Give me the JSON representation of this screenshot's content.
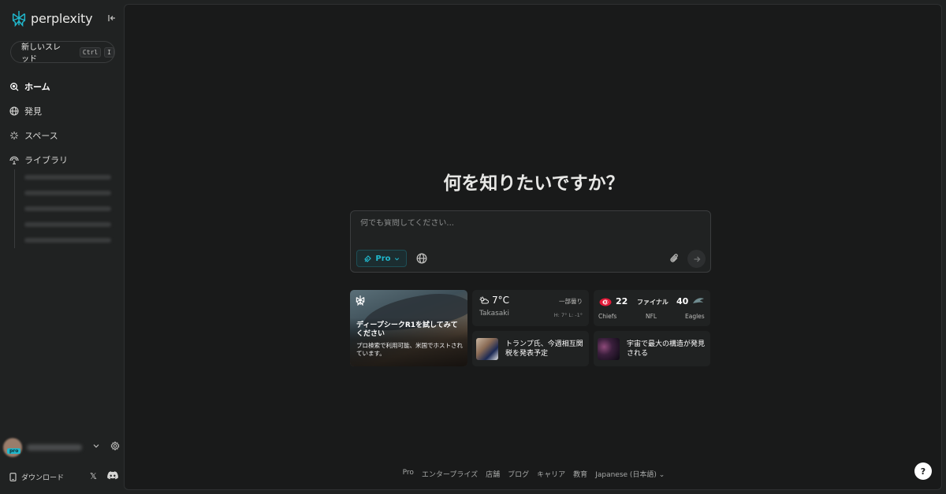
{
  "app": {
    "name": "perplexity",
    "accent": "#20b8cd",
    "background": "#202222",
    "panel": "#191a1a"
  },
  "sidebar": {
    "new_thread_label": "新しいスレッド",
    "shortcut_keys": [
      "Ctrl",
      "I"
    ],
    "nav_items": [
      {
        "label": "ホーム",
        "icon": "home-search-icon",
        "active": true
      },
      {
        "label": "発見",
        "icon": "globe-icon"
      },
      {
        "label": "スペース",
        "icon": "sparkle-icon"
      },
      {
        "label": "ライブラリ",
        "icon": "library-icon"
      }
    ],
    "library_items_count_blurred": 5,
    "user": {
      "badge": "pro"
    },
    "download_label": "ダウンロード"
  },
  "main": {
    "heading": "何を知りたいですか？",
    "ask": {
      "placeholder": "何でも質問してください...",
      "pro_label": "Pro"
    },
    "cards": {
      "featured": {
        "title": "ディープシークR1を試してみてください",
        "subtitle": "プロ検索で利用可能、米国でホストされています。"
      },
      "weather": {
        "temp": "7°C",
        "condition": "一部曇り",
        "city": "Takasaki",
        "high_low": "H: 7° L: -1°"
      },
      "score": {
        "home_score": "22",
        "away_score": "40",
        "stage": "ファイナル",
        "home_team": "Chiefs",
        "league": "NFL",
        "away_team": "Eagles"
      },
      "news": [
        {
          "title": "トランプ氏、今週相互関税を発表予定"
        },
        {
          "title": "宇宙で最大の構造が発見される"
        }
      ]
    },
    "footer_links": [
      "Pro",
      "エンタープライズ",
      "店舗",
      "ブログ",
      "キャリア",
      "教育",
      "Japanese (日本語)"
    ],
    "help_label": "?"
  }
}
